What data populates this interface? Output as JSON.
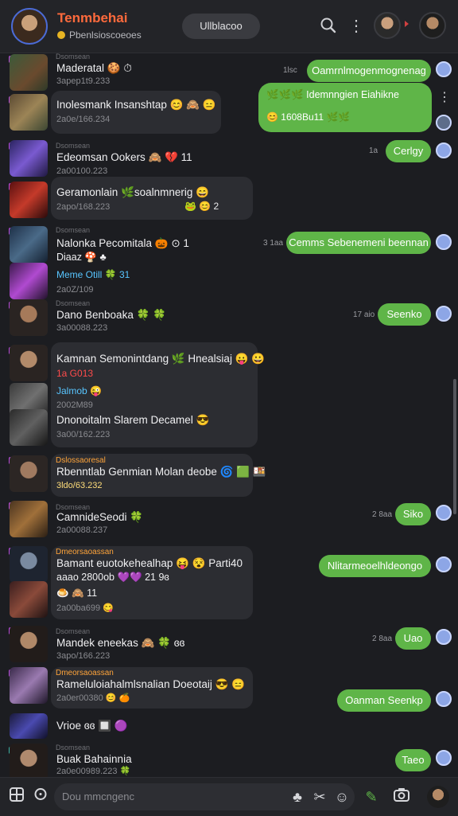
{
  "header": {
    "title": "Tenmbehai",
    "subtitle": "Pbenlsioscoeoes",
    "pill_label": "Ullblacoo"
  },
  "composer": {
    "placeholder": "Dou mmcngenc"
  },
  "incoming": [
    {
      "tag": "Dsomsean",
      "title": "Maderatal 🍪 ⏱",
      "time": "3apep1t9.233"
    },
    {
      "tag": "",
      "title": "Inolesmank Insanshtap 😊 🙈 😑",
      "time": "2a0e/166.234"
    },
    {
      "tag": "Dsomsean",
      "title": "Edeomsan Ookers 🙈 💔 11",
      "time": "2a00100.223"
    },
    {
      "tag": "",
      "title": "Geramonlain 🌿soalnmnerig 😄",
      "time": "2apo/168.223",
      "extra": "🐸 😊 2"
    },
    {
      "tag": "Dsomsean",
      "title": "Nalonka Pecomitala 🎃 ⊙ 1",
      "line2": "Diaaz 🍄 ♣",
      "cyan": "Meme Otill 🍀 31",
      "time": "2a0Z/109"
    },
    {
      "tag": "Dsomsean",
      "title": "Dano Benboaka 🍀 🍀",
      "time": "3a00088.223"
    },
    {
      "tag": "",
      "title": "Kamnan Semonintdang 🌿 Hnealsiaj 😛 😀",
      "red": "1a G013",
      "cyan": "Jalmob 😜",
      "mid": "2002M89",
      "title2": "Dnonoitalm Slarem Decamel 😎",
      "time": "3a00/162.223"
    },
    {
      "tag": "Dslossaoresal",
      "title": "Rbenntlab Genmian Molan deobe 🌀 🟩 🍱",
      "time": "3ldo/63.232"
    },
    {
      "tag": "Dsomsean",
      "title": "CamnideSeodi 🍀",
      "time": "2a00088.237"
    },
    {
      "tag": "Dmeorsaoassan",
      "title": "Bamant euotokehealhap 😝 😵 Parti40",
      "line2": "aaao 2800ob 💜💜 21 9ɞ",
      "line3": "🍮 🙈 11",
      "time": "2a00ba699 😋"
    },
    {
      "tag": "Dsomsean",
      "title": "Mandek eneekas 🙈 🍀 ɞɞ",
      "time": "3apo/166.223"
    },
    {
      "tag": "Dmeorsaoassan",
      "title": "Rameluloiahalmlsnalian Doeotaij 😎 😑",
      "time": "2a0er00380 😊 🍊"
    },
    {
      "tag": "",
      "title": "Vrioe ɞɞ 🔲 🟣",
      "time": ""
    },
    {
      "tag": "Dsomsean",
      "title": "Buak Bahainnia",
      "time": "2a0e00989.223 🍀"
    }
  ],
  "outgoing": [
    {
      "time": "1lsc",
      "text": "Oamrnlmogenmognenag"
    },
    {
      "time": "",
      "text": "🌿🌿🌿 Idemnngien Eiahikne",
      "sub": "😊 1608Bu11 🌿🌿"
    },
    {
      "time": "1a",
      "text": "Cerlgy"
    },
    {
      "time": "3 1aa",
      "text": "Cemms Sebenemeni beennan"
    },
    {
      "time": "17 aio",
      "text": "Seenko"
    },
    {
      "time": "2 8aa",
      "text": "Siko"
    },
    {
      "time": "",
      "text": "Nlitarmeoelhldeongo"
    },
    {
      "time": "2 8aa",
      "text": "Uao"
    },
    {
      "time": "",
      "text": "Oanman Seenkp"
    },
    {
      "time": "",
      "text": "Taeo"
    }
  ],
  "colors": {
    "accent_bubble": "#5fb548",
    "brand_title": "#ff6a3c",
    "background": "#1c1d21"
  }
}
